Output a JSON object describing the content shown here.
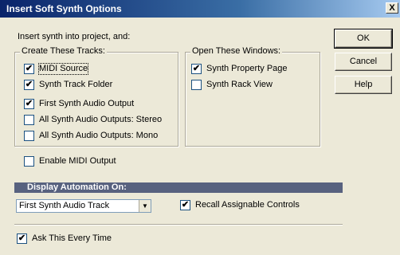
{
  "window": {
    "title": "Insert Soft Synth Options",
    "close_glyph": "X"
  },
  "intro": "Insert synth into project, and:",
  "tracks_group": {
    "legend": "Create These Tracks:",
    "items": [
      {
        "label": "MIDI Source",
        "checked": true
      },
      {
        "label": "Synth Track Folder",
        "checked": true
      },
      {
        "label": "First Synth Audio Output",
        "checked": true
      },
      {
        "label": "All Synth Audio Outputs: Stereo",
        "checked": false
      },
      {
        "label": "All Synth Audio Outputs: Mono",
        "checked": false
      }
    ]
  },
  "windows_group": {
    "legend": "Open These Windows:",
    "items": [
      {
        "label": "Synth Property Page",
        "checked": true
      },
      {
        "label": "Synth Rack View",
        "checked": false
      }
    ]
  },
  "enable_midi_output": {
    "label": "Enable MIDI Output",
    "checked": false
  },
  "automation": {
    "heading": "Display Automation On:",
    "selected": "First Synth Audio Track",
    "recall": {
      "label": "Recall Assignable Controls",
      "checked": true
    }
  },
  "ask_every_time": {
    "label": "Ask This Every Time",
    "checked": true
  },
  "buttons": {
    "ok": "OK",
    "cancel": "Cancel",
    "help": "Help"
  },
  "checkmark_glyph": "✔",
  "dropdown_arrow_glyph": "▼"
}
